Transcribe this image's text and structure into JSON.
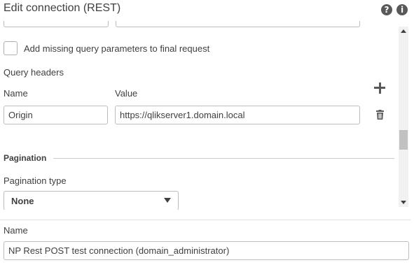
{
  "dialog": {
    "title": "Edit connection (REST)",
    "help_icon": "question-icon",
    "info_icon": "info-icon",
    "help_glyph": "?",
    "info_glyph": "i"
  },
  "form": {
    "add_missing_query_params_label": "Add missing query parameters to final request",
    "add_missing_query_params_checked": false,
    "query_headers_label": "Query headers",
    "headers_name_col": "Name",
    "headers_value_col": "Value",
    "headers": [
      {
        "name": "Origin",
        "value": "https://qlikserver1.domain.local"
      }
    ],
    "add_icon": "plus-icon",
    "delete_icon": "trash-icon",
    "pagination_section": "Pagination",
    "pagination_type_label": "Pagination type",
    "pagination_type_value": "None"
  },
  "footer": {
    "name_label": "Name",
    "name_value": "NP Rest POST test connection (domain_administrator)"
  },
  "colors": {
    "text": "#404040",
    "border": "#bdbdbd",
    "icon": "#595959"
  }
}
